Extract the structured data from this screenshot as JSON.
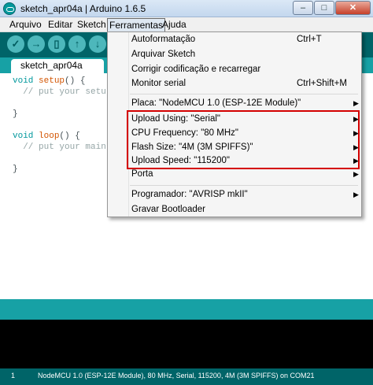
{
  "window": {
    "title": "sketch_apr04a | Arduino 1.6.5",
    "minimize_glyph": "–",
    "maximize_glyph": "□",
    "close_glyph": "✕"
  },
  "menubar": {
    "items": [
      "Arquivo",
      "Editar",
      "Sketch",
      "Ferramentas",
      "Ajuda"
    ],
    "active": "Ferramentas"
  },
  "toolbar": {
    "buttons": [
      {
        "icon": "check-icon",
        "glyph": "✓"
      },
      {
        "icon": "upload-arrow-icon",
        "glyph": "→"
      },
      {
        "icon": "new-file-icon",
        "glyph": "▯"
      },
      {
        "icon": "open-arrow-up-icon",
        "glyph": "↑"
      },
      {
        "icon": "save-arrow-down-icon",
        "glyph": "↓"
      }
    ]
  },
  "tab": {
    "label": "sketch_apr04a"
  },
  "editor": {
    "lines": [
      {
        "kw": "void",
        "fn": "setup",
        "rest": "() {"
      },
      {
        "comment": "  // put your setu"
      },
      {
        "text": ""
      },
      {
        "text": "}"
      },
      {
        "text": ""
      },
      {
        "kw": "void",
        "fn": "loop",
        "rest": "() {"
      },
      {
        "comment": "  // put your main"
      },
      {
        "text": ""
      },
      {
        "text": "}"
      }
    ]
  },
  "tools_menu": {
    "group1": [
      {
        "label": "Autoformatação",
        "shortcut": "Ctrl+T"
      },
      {
        "label": "Arquivar Sketch",
        "shortcut": ""
      },
      {
        "label": "Corrigir codificação e recarregar",
        "shortcut": ""
      },
      {
        "label": "Monitor serial",
        "shortcut": "Ctrl+Shift+M"
      }
    ],
    "board": {
      "label": "Placa: \"NodeMCU 1.0 (ESP-12E Module)\"",
      "submenu": true
    },
    "highlighted_group": [
      {
        "label": "Upload Using: \"Serial\"",
        "submenu": true
      },
      {
        "label": "CPU Frequency: \"80 MHz\"",
        "submenu": true
      },
      {
        "label": "Flash Size: \"4M (3M SPIFFS)\"",
        "submenu": true
      },
      {
        "label": "Upload Speed: \"115200\"",
        "submenu": true
      }
    ],
    "port": {
      "label": "Porta",
      "submenu": true
    },
    "group3": [
      {
        "label": "Programador: \"AVRISP mkII\"",
        "submenu": true
      },
      {
        "label": "Gravar Bootloader",
        "submenu": false
      }
    ],
    "highlight_color": "#d40000"
  },
  "statusbar": {
    "line_number": "1",
    "text": "NodeMCU 1.0 (ESP-12E Module), 80 MHz, Serial, 115200, 4M (3M SPIFFS) on COM21"
  },
  "colors": {
    "toolbar": "#006468",
    "tabstrip": "#17a1a5",
    "console": "#000000"
  }
}
